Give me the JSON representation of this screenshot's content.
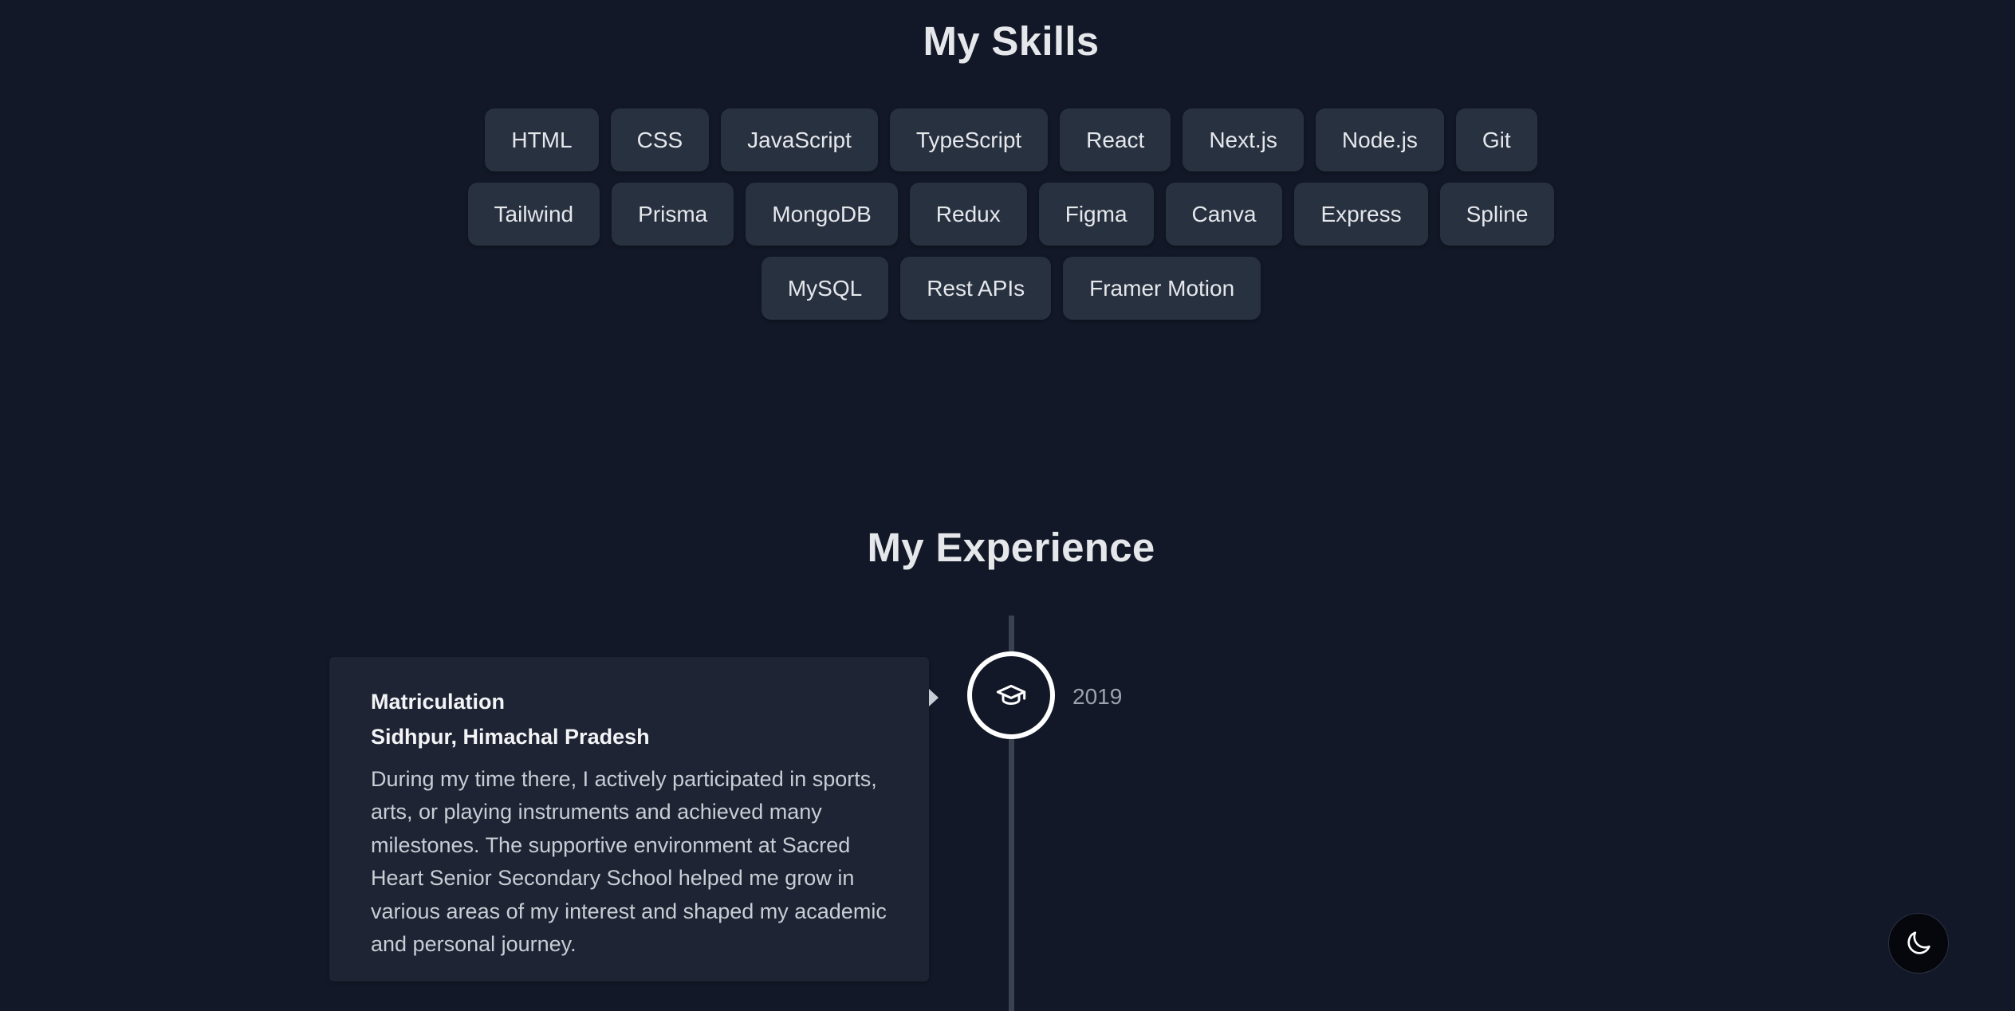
{
  "skills": {
    "title": "My Skills",
    "rows": [
      [
        "HTML",
        "CSS",
        "JavaScript",
        "TypeScript",
        "React",
        "Next.js",
        "Node.js",
        "Git"
      ],
      [
        "Tailwind",
        "Prisma",
        "MongoDB",
        "Redux",
        "Figma",
        "Canva",
        "Express",
        "Spline"
      ],
      [
        "MySQL",
        "Rest APIs",
        "Framer Motion"
      ]
    ]
  },
  "experience": {
    "title": "My Experience",
    "items": [
      {
        "title": "Matriculation",
        "location": "Sidhpur, Himachal Pradesh",
        "description": "During my time there, I actively participated in sports, arts, or playing instruments and achieved many milestones. The supportive environment at Sacred Heart Senior Secondary School helped me grow in various areas of my interest and shaped my academic and personal journey.",
        "date": "2019",
        "icon": "graduation-cap-icon"
      }
    ]
  },
  "theme_toggle": {
    "icon": "moon-icon"
  },
  "colors": {
    "background": "#121827",
    "chip": "#283140",
    "card": "#1e2434",
    "timeline": "#3a4252"
  }
}
